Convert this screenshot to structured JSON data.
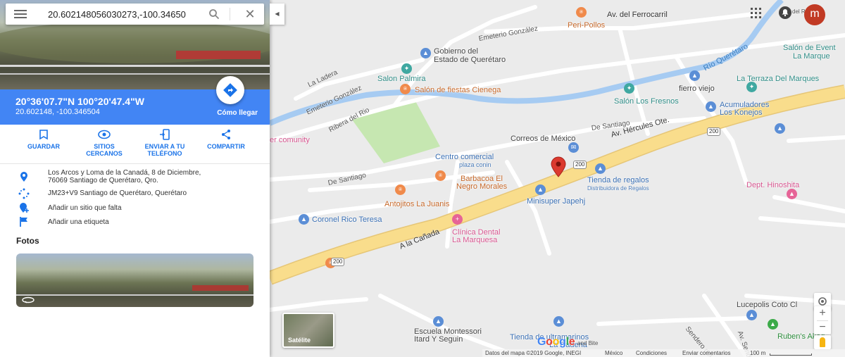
{
  "search": {
    "query": "20.602148056030273,-100.34650",
    "menu_icon": "hamburger-menu-icon",
    "search_icon": "magnifier-icon",
    "close_icon": "close-icon"
  },
  "place": {
    "dms": "20°36'07.7\"N 100°20'47.4\"W",
    "decimal": "20.602148, -100.346504",
    "directions_label": "Cómo llegar"
  },
  "actions": [
    {
      "label_1": "GUARDAR",
      "label_2": "",
      "icon": "bookmark-icon"
    },
    {
      "label_1": "SITIOS",
      "label_2": "CERCANOS",
      "icon": "eye-icon"
    },
    {
      "label_1": "ENVIAR A TU",
      "label_2": "TELÉFONO",
      "icon": "send-to-phone-icon"
    },
    {
      "label_1": "COMPARTIR",
      "label_2": "",
      "icon": "share-icon"
    }
  ],
  "details": {
    "address_line1": "Los Arcos y Loma de la Canadá, 8 de Diciembre,",
    "address_line2": "76069 Santiago de Querétaro, Qro.",
    "plus_code": "JM23+V9 Santiago de Querétaro, Querétaro",
    "add_place": "Añadir un sitio que falta",
    "add_label": "Añadir una etiqueta"
  },
  "photos": {
    "title": "Fotos"
  },
  "map": {
    "accent_road": "#f9dd8c",
    "river": "#a6cbf2",
    "park": "#c6e7b1",
    "marker": "#db3a2f",
    "labels": {
      "peri_pollos": "Peri-Pollos",
      "av_ferrocarril": "Av. del Ferrocarril",
      "emeterio_1": "Emeterio González",
      "emeterio_2": "Emeterio González",
      "gobierno_1": "Gobierno del",
      "gobierno_2": "Estado de Querétaro",
      "salon_palmira": "Salon Palmira",
      "salon_cienega": "Salón de fiestas Cienega",
      "la_ladera": "La Ladera",
      "ribera": "Ribera del Rio",
      "rio_queretaro": "Río Querétaro",
      "salon_eventos_1": "Salón de Event",
      "salon_eventos_2": "La Marque",
      "terraza": "La Terraza Del Marques",
      "fierro": "fierro viejo",
      "salon_fresnos": "Salón Los Fresnos",
      "acumuladores_1": "Acumuladores",
      "acumuladores_2": "Los Konejos",
      "de_santiago_1": "De Santiago",
      "av_hercules": "Av. Hércules Ote.",
      "correos": "Correos de México",
      "community": "er comunity",
      "centro_1": "Centro comercial",
      "centro_2": "plaza conin",
      "tienda_1": "Tienda de regalos",
      "tienda_2": "Distribuidora de Regalos",
      "barbacoa_1": "Barbacoa El",
      "barbacoa_2": "Negro Morales",
      "de_santiago_2": "De Santiago",
      "antojitos": "Antojitos La Juanis",
      "minisuper": "Minisuper Japehj",
      "hinoshita": "Dept. Hinoshita",
      "coronel": "Coronel Rico Teresa",
      "a_la_canada": "A la Cañada",
      "clinica_1": "Clínica Dental",
      "clinica_2": "La Marquesa",
      "lucepolis": "Lucepolis Coto Cl",
      "escuela_1": "Escuela Montessori",
      "escuela_2": "Itard Y Seguin",
      "ultramarinos_1": "Tienda de ultramarinos",
      "ultramarinos_2": "La Cadena",
      "rubens": "Ruben's Akad",
      "sendero": "Sendero del Desti",
      "av_senda": "Av. Senda E",
      "del_rio": "del Río",
      "shield_1": "200",
      "shield_2": "200",
      "shield_3": "200"
    }
  },
  "controls": {
    "satellite_label": "Satélite",
    "zoom_in": "+",
    "zoom_out": "−",
    "avatar_letter": "m",
    "apps_icon": "apps-grid-icon",
    "notif_icon": "notifications-icon"
  },
  "footer": {
    "google_g": "G",
    "google_o1": "o",
    "google_o2": "o",
    "google_g2": "g",
    "google_l": "l",
    "google_e": "e",
    "partner": "and Bite",
    "data": "Datos del mapa ©2019 Google, INEGI",
    "country": "México",
    "terms": "Condiciones",
    "feedback": "Enviar comentarios",
    "scale": "100 m"
  }
}
